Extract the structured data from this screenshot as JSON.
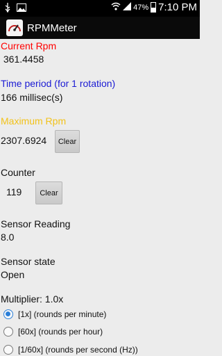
{
  "status_bar": {
    "battery_percent": "47%",
    "time": "7:10 PM"
  },
  "app": {
    "title": "RPMMeter"
  },
  "current_rpm": {
    "label": "Current Rpm",
    "value": " 361.4458",
    "color": "#ff0000"
  },
  "time_period": {
    "label": "Time period (for 1 rotation)",
    "value": "166 millisec(s)",
    "color": "#1b1bd4"
  },
  "maximum_rpm": {
    "label": "Maximum Rpm",
    "value": "2307.6924",
    "clear_label": "Clear",
    "color": "#f2c21a"
  },
  "counter": {
    "label": "Counter",
    "value": "119",
    "clear_label": "Clear"
  },
  "sensor_reading": {
    "label": "Sensor Reading",
    "value": "8.0"
  },
  "sensor_state": {
    "label": "Sensor state",
    "value": "Open"
  },
  "multiplier": {
    "label": "Multiplier: 1.0x",
    "options": [
      {
        "label": "[1x] (rounds per minute)",
        "selected": true
      },
      {
        "label": "[60x] (rounds per hour)",
        "selected": false
      },
      {
        "label": "[1/60x] (rounds per second (Hz))",
        "selected": false
      }
    ]
  }
}
